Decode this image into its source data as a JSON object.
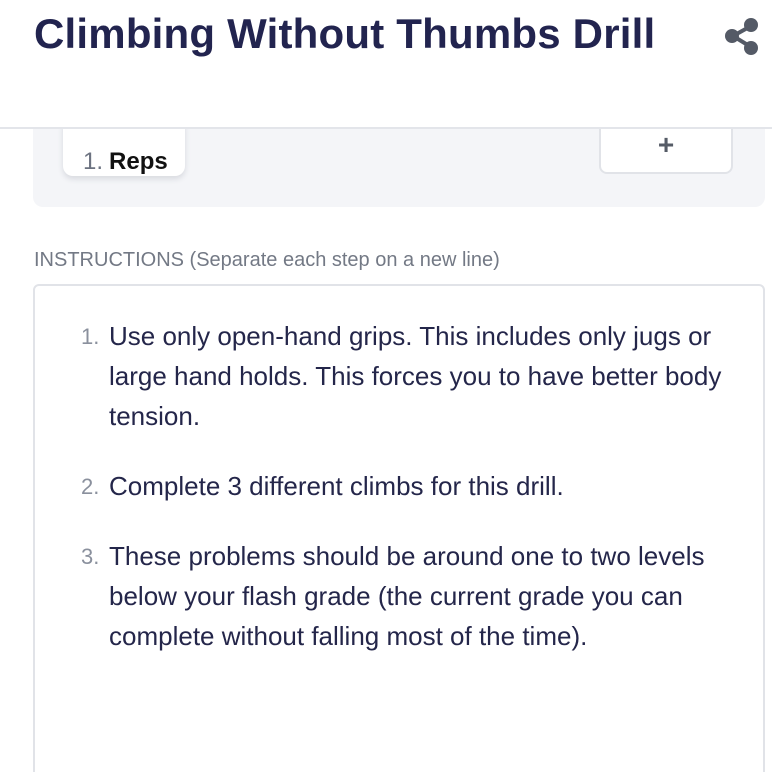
{
  "header": {
    "title": "Climbing Without Thumbs Drill",
    "share_icon": "share-icon"
  },
  "sets": {
    "tabs": [
      {
        "number": "1.",
        "label": "Reps"
      }
    ],
    "add_label": "+"
  },
  "instructions": {
    "label": "INSTRUCTIONS (Separate each step on a new line)",
    "steps": [
      {
        "number": "1.",
        "text": "Use only open-hand grips. This includes only jugs or large hand holds. This forces you to have better body tension."
      },
      {
        "number": "2.",
        "text": "Complete 3 different climbs for this drill."
      },
      {
        "number": "3.",
        "text": "These problems should be around one to two levels below your flash grade (the current grade you can complete without falling most of the time)."
      }
    ]
  },
  "colors": {
    "title": "#22244f",
    "panel_bg": "#f4f5f8",
    "border": "#e1e3e8",
    "muted_text": "#737985"
  }
}
